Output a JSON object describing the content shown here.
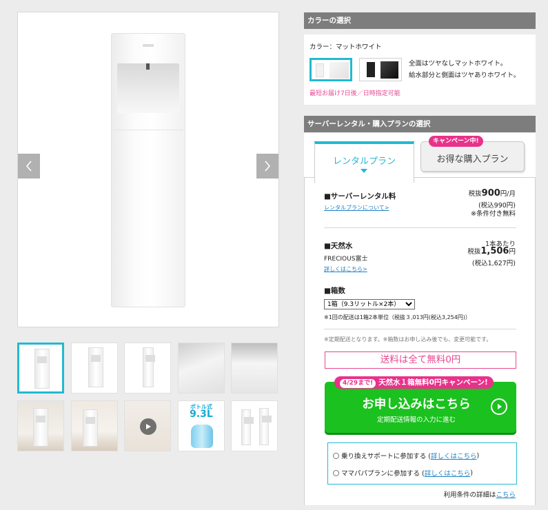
{
  "gallery": {
    "prev_label": "previous-image",
    "next_label": "next-image",
    "thumbs": [
      {
        "kind": "server-front"
      },
      {
        "kind": "server-angle"
      },
      {
        "kind": "server-side"
      },
      {
        "kind": "closeup-top"
      },
      {
        "kind": "closeup-nozzle"
      },
      {
        "kind": "room-1"
      },
      {
        "kind": "room-2"
      },
      {
        "kind": "video"
      },
      {
        "kind": "bottle",
        "small": "ボトル式",
        "big": "9.3L"
      },
      {
        "kind": "dimensions"
      }
    ]
  },
  "color_section": {
    "header": "カラーの選択",
    "label": "カラー：マットホワイト",
    "desc_line1": "全面はツヤなしマットホワイト。",
    "desc_line2": "給水部分と側面はツヤありホワイト。",
    "delivery_note": "最短お届け7日後／日時指定可能"
  },
  "plan_section": {
    "header": "サーバーレンタル・購入プランの選択",
    "tab_rental": "レンタルプラン",
    "tab_purchase": "お得な購入プラン",
    "campaign_badge": "キャンペーン中!",
    "rental_fee": {
      "title": "■サーバーレンタル料",
      "link": "レンタルプランについて>",
      "price_prefix": "税抜",
      "price": "900",
      "price_suffix": "円/月",
      "tax_in": "(税込990円)",
      "note": "※条件付き無料"
    },
    "water": {
      "title": "■天然水",
      "name": "FRECIOUS富士",
      "link": "詳しくはこちら>",
      "per_unit": "1本あたり",
      "price_prefix": "税抜",
      "price": "1,506",
      "price_suffix": "円",
      "tax_in": "(税込1,627円)"
    },
    "boxes": {
      "title": "■箱数",
      "selected": "1箱（9.3リットル×2本）",
      "note": "※1回の配送は1箱2本単位（税抜３,013円(税込3,254円)）"
    },
    "regular_note": "※定期配送となります。※箱数はお申し込み後でも、変更可能です。",
    "free_shipping": "送料は全て無料0円",
    "cta": {
      "badge_date": "4/29まで!",
      "badge_text": "天然水１箱無料0円キャンペーン!",
      "main": "お申し込みはこちら",
      "sub": "定期配送情報の入力に進む"
    },
    "options": [
      {
        "text": "乗り換えサポートに参加する (",
        "link": "詳しくはこちら",
        "close": ")"
      },
      {
        "text": "ママパパプランに参加する (",
        "link": "詳しくはこちら",
        "close": ")"
      }
    ],
    "terms_text": "利用条件の詳細は",
    "terms_link": "こちら"
  },
  "colors": {
    "accent": "#22b9d1",
    "pink": "#e8328a",
    "cta_green": "#1bc11e",
    "header_gray": "#7d7d7d"
  }
}
